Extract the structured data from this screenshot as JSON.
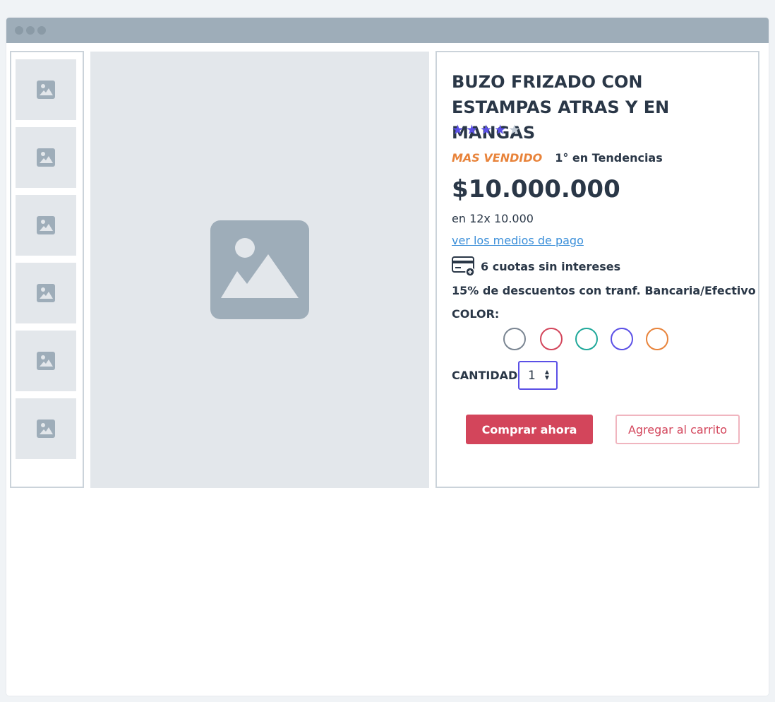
{
  "product": {
    "title": "BUZO FRIZADO CON ESTAMPAS ATRAS Y EN MANGAS",
    "rating": 4,
    "rating_max": 5,
    "badge": "MAS VENDIDO",
    "trend": "1° en Tendencias",
    "price": "$10.000.000",
    "installments": "en 12x 10.000",
    "payment_link": "ver los medios de pago",
    "cuotas": "6 cuotas sin intereses",
    "discount": "15% de descuentos con tranf. Bancaria/Efectivo",
    "color_label": "COLOR:",
    "colors": [
      "#7a8592",
      "#d3455b",
      "#1fa89a",
      "#5b50e6",
      "#e8833a"
    ],
    "quantity_label": "CANTIDAD:",
    "quantity": "1",
    "buy_label": "Comprar ahora",
    "cart_label": "Agregar al carrito"
  },
  "theme": {
    "accent": "#5b50e6",
    "buy": "#d3455b",
    "best_seller": "#e8833a",
    "link": "#3b8fd9",
    "placeholder": "#e3e7eb",
    "placeholder_icon": "#9eadb9"
  },
  "icons": {
    "thumbnail": "image-icon",
    "main": "image-icon",
    "payment": "credit-card-icon"
  }
}
